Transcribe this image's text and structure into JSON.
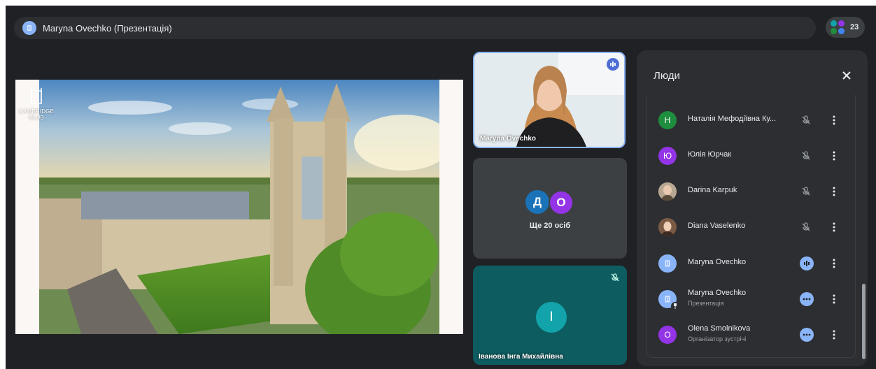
{
  "meeting": {
    "title": "Maryna Ovechko (Презентація)",
    "participants_count": "23"
  },
  "slide": {
    "logo_text": "CAMBRIDGE\nCLUB"
  },
  "tiles": {
    "video": {
      "name": "Maryna Ovechko"
    },
    "more": {
      "avatars": [
        "Д",
        "О"
      ],
      "label": "Ще 20 осіб"
    },
    "teal": {
      "initial": "І",
      "name": "Іванова Інга Михайлівна"
    }
  },
  "people_panel": {
    "title": "Люди",
    "participants": [
      {
        "initial": "Н",
        "name": "Наталія Мефодіївна Ку...",
        "status": "muted"
      },
      {
        "initial": "Ю",
        "name": "Юлія Юрчак",
        "status": "muted"
      },
      {
        "initial": "",
        "name": "Darina Karpuk",
        "status": "muted"
      },
      {
        "initial": "",
        "name": "Diana Vaselenko",
        "status": "muted"
      },
      {
        "initial": "",
        "name": "Maryna Ovechko",
        "status": "speaking"
      },
      {
        "initial": "",
        "name": "Maryna Ovechko",
        "subtitle": "Презентація",
        "status": "more"
      },
      {
        "initial": "O",
        "name": "Olena Smolnikova",
        "subtitle": "Організатор зустрічі",
        "status": "more"
      }
    ]
  },
  "colors": {
    "background": "#202124",
    "panel": "#2d2e31",
    "accent": "#8ab4f8",
    "avatar_green": "#1e8e3e",
    "avatar_purple": "#9334e6",
    "avatar_teal": "#12a4aa",
    "avatar_blue": "#4285f4"
  },
  "icons": [
    "meeting-avatar-icon",
    "participants-dots-icon",
    "speaking-icon",
    "mic-off-icon",
    "close-icon",
    "more-vert-icon",
    "pin-icon"
  ]
}
